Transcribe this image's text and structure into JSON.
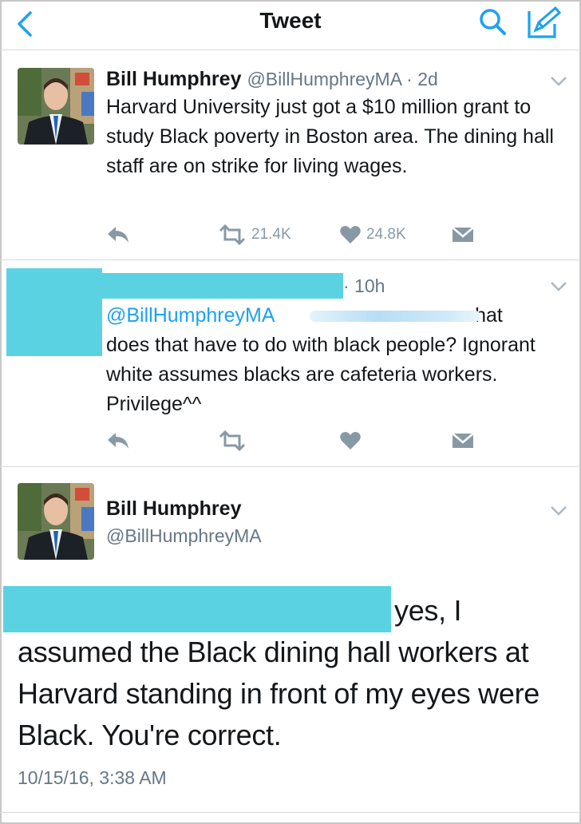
{
  "header": {
    "title": "Tweet",
    "back_icon": "back-chevron-icon",
    "search_icon": "search-icon",
    "compose_icon": "compose-icon"
  },
  "tweet1": {
    "name": "Bill Humphrey",
    "handle": "@BillHumphreyMA",
    "separator": " · ",
    "time": "2d",
    "text": "Harvard University just got a $10 million grant to study Black poverty in Boston area. The dining hall staff are on strike for living wages.",
    "retweets": "21.4K",
    "likes": "24.8K"
  },
  "tweet2": {
    "time_suffix": "· 10h",
    "mention": "@BillHumphreyMA",
    "text_after_mention": " what",
    "text": "does that have to do with black people? Ignorant white assumes blacks are cafeteria workers. Privilege^^"
  },
  "tweet3": {
    "name": "Bill Humphrey",
    "handle": "@BillHumphreyMA",
    "text_after_redaction": "yes, I",
    "text": "assumed the Black dining hall workers at Harvard standing in front of my eyes were Black. You're correct.",
    "timestamp": "10/15/16, 3:38 AM"
  },
  "colors": {
    "accent": "#1da1f2",
    "muted": "#657786",
    "icon_gray": "#8899a6",
    "redaction": "#5bd2e2"
  }
}
